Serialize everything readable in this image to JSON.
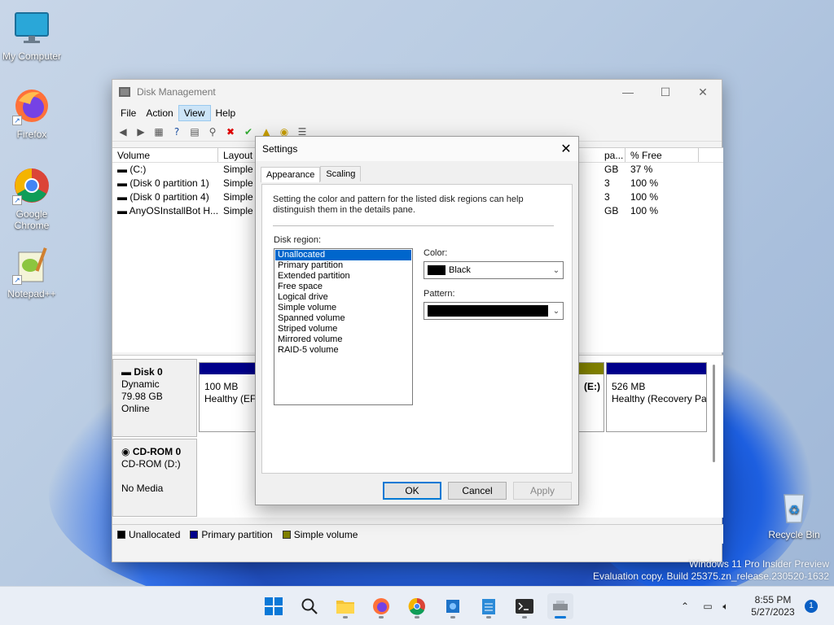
{
  "desktop": {
    "icons": [
      {
        "label": "My Computer"
      },
      {
        "label": "Firefox"
      },
      {
        "label": "Google Chrome"
      },
      {
        "label": "Notepad++"
      },
      {
        "label": "Recycle Bin"
      }
    ],
    "watermark_line1": "Windows 11 Pro Insider Preview",
    "watermark_line2": "Evaluation copy. Build 25375.zn_release.230520-1632"
  },
  "window": {
    "title": "Disk Management",
    "menu": [
      "File",
      "Action",
      "View",
      "Help"
    ],
    "active_menu": "View",
    "columns": [
      "Volume",
      "Layout",
      "pa...",
      "% Free"
    ],
    "rows": [
      {
        "volume": "(C:)",
        "layout": "Simple",
        "cap": "GB",
        "free": "37 %"
      },
      {
        "volume": "(Disk 0 partition 1)",
        "layout": "Simple",
        "cap": "3",
        "free": "100 %"
      },
      {
        "volume": "(Disk 0 partition 4)",
        "layout": "Simple",
        "cap": "3",
        "free": "100 %"
      },
      {
        "volume": "AnyOSInstallBot H...",
        "layout": "Simple",
        "cap": "GB",
        "free": "100 %"
      }
    ],
    "disk0": {
      "name": "Disk 0",
      "type": "Dynamic",
      "size": "79.98 GB",
      "status": "Online"
    },
    "cdrom": {
      "name": "CD-ROM 0",
      "drive": "CD-ROM (D:)",
      "status": "No Media"
    },
    "parts": [
      {
        "size": "100 MB",
        "status": "Healthy (EFI"
      },
      {
        "label": "(E:)"
      },
      {
        "size": "526 MB",
        "status": "Healthy (Recovery Pa"
      }
    ],
    "legend": [
      {
        "label": "Unallocated",
        "color": "#000000"
      },
      {
        "label": "Primary partition",
        "color": "#00008b"
      },
      {
        "label": "Simple volume",
        "color": "#808000"
      }
    ]
  },
  "dialog": {
    "title": "Settings",
    "tabs": [
      "Appearance",
      "Scaling"
    ],
    "description": "Setting the color and pattern for the listed disk regions can help distinguish them in the details pane.",
    "region_label": "Disk region:",
    "regions": [
      "Unallocated",
      "Primary partition",
      "Extended partition",
      "Free space",
      "Logical drive",
      "Simple volume",
      "Spanned volume",
      "Striped volume",
      "Mirrored volume",
      "RAID-5 volume"
    ],
    "selected_region": "Unallocated",
    "color_label": "Color:",
    "color_value": "Black",
    "pattern_label": "Pattern:",
    "ok": "OK",
    "cancel": "Cancel",
    "apply": "Apply"
  },
  "taskbar": {
    "time": "8:55 PM",
    "date": "5/27/2023",
    "notification_count": "1"
  }
}
